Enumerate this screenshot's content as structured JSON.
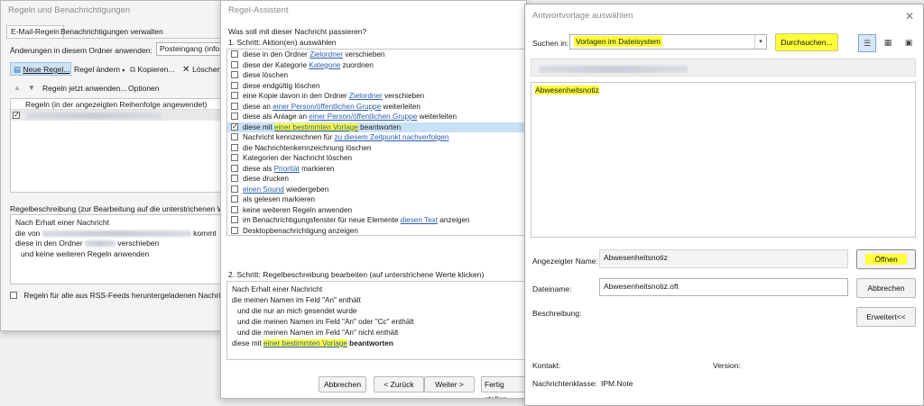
{
  "rules_window": {
    "title": "Regeln und Benachrichtigungen",
    "tabs": [
      "E-Mail-Regeln",
      "Benachrichtigungen verwalten"
    ],
    "folder_label": "Änderungen in diesem Ordner anwenden:",
    "folder_value": "Posteingang (info@",
    "toolbar": {
      "new_rule": "Neue Regel...",
      "change_rule": "Regel ändern",
      "copy": "Kopieren...",
      "delete": "Löschen"
    },
    "run_rules": "Regeln jetzt anwenden...",
    "options": "Optionen",
    "list_header": "Regeln (in der angezeigten Reihenfolge angewendet)",
    "desc_label": "Regelbeschreibung (zur Bearbeitung auf die unterstrichenen W",
    "desc_lines": {
      "l1": "Nach Erhalt einer Nachricht",
      "l2a": "die von",
      "l2b": "kommt",
      "l3a": "diese in den Ordner",
      "l3b": "verschieben",
      "l4": "und keine weiteren Regeln anwenden"
    },
    "rss_checkbox": "Regeln für alle aus RSS-Feeds heruntergeladenen Nachricht"
  },
  "wizard": {
    "title": "Regel-Assistent",
    "question": "Was soll mit dieser Nachricht passieren?",
    "step1": "1. Schritt: Aktion(en) auswählen",
    "actions": [
      {
        "pre": "diese in den Ordner ",
        "link": "Zielordner",
        "post": " verschieben",
        "checked": false
      },
      {
        "pre": "diese der Kategorie ",
        "link": "Kategorie",
        "post": " zuordnen",
        "checked": false
      },
      {
        "pre": "diese löschen",
        "link": "",
        "post": "",
        "checked": false
      },
      {
        "pre": "diese endgültig löschen",
        "link": "",
        "post": "",
        "checked": false
      },
      {
        "pre": "eine Kopie davon in den Ordner ",
        "link": "Zielordner",
        "post": " verschieben",
        "checked": false
      },
      {
        "pre": "diese an ",
        "link": "einer Person/öffentlichen Gruppe",
        "post": " weiterleiten",
        "checked": false
      },
      {
        "pre": "diese als Anlage an ",
        "link": "einer Person/öffentlichen Gruppe",
        "post": " weiterleiten",
        "checked": false
      },
      {
        "pre": "diese mit ",
        "link": "einer bestimmten Vorlage",
        "post": " beantworten",
        "checked": true
      },
      {
        "pre": "Nachricht kennzeichnen für ",
        "link": "zu diesem Zeitpunkt nachverfolgen",
        "post": "",
        "checked": false
      },
      {
        "pre": "die Nachrichtenkennzeichnung löschen",
        "link": "",
        "post": "",
        "checked": false
      },
      {
        "pre": "Kategorien der Nachricht löschen",
        "link": "",
        "post": "",
        "checked": false
      },
      {
        "pre": "diese als ",
        "link": "Priorität",
        "post": " markieren",
        "checked": false
      },
      {
        "pre": "diese drucken",
        "link": "",
        "post": "",
        "checked": false
      },
      {
        "pre": "",
        "link": "einen Sound",
        "post": " wiedergeben",
        "checked": false
      },
      {
        "pre": "als gelesen markieren",
        "link": "",
        "post": "",
        "checked": false
      },
      {
        "pre": "keine weiteren Regeln anwenden",
        "link": "",
        "post": "",
        "checked": false
      },
      {
        "pre": "im Benachrichtigungsfenster für neue Elemente ",
        "link": "diesen Text",
        "post": " anzeigen",
        "checked": false
      },
      {
        "pre": "Desktopbenachrichtigung anzeigen",
        "link": "",
        "post": "",
        "checked": false
      }
    ],
    "step2": "2. Schritt: Regelbeschreibung bearbeiten (auf unterstrichene Werte klicken)",
    "desc": {
      "l1": "Nach Erhalt einer Nachricht",
      "l2": "die meinen Namen im Feld \"An\" enthält",
      "l3": "und die nur an mich gesendet wurde",
      "l4": "und die meinen Namen im Feld \"An\" oder \"Cc\" enthält",
      "l5": "und die meinen Namen im Feld \"An\" nicht enthält",
      "l6_pre": "diese mit ",
      "l6_link": "einer bestimmten Vorlage",
      "l6_post": " beantworten"
    },
    "buttons": {
      "cancel": "Abbrechen",
      "back": "< Zurück",
      "next": "Weiter >",
      "finish": "Fertig stellen"
    }
  },
  "template_dialog": {
    "title": "Antwortvorlage auswählen",
    "search_label": "Suchen in:",
    "search_value": "Vorlagen im Dateisystem",
    "browse": "Durchsuchen...",
    "file_item": "Abwesenheitsnotiz",
    "display_name_label": "Angezeigter Name:",
    "display_name_value": "Abwesenheitsnotiz",
    "open_btn": "Öffnen",
    "filename_label": "Dateiname:",
    "filename_value": "Abwesenheitsnotiz.oft",
    "cancel_btn": "Abbrechen",
    "description_label": "Beschreibung:",
    "advanced_btn": "Erweitert<<",
    "contact_label": "Kontakt:",
    "version_label": "Version:",
    "class_label": "Nachrichtenklasse:",
    "class_value": "IPM.Note"
  },
  "colors": {
    "highlight": "#ffff3a",
    "link": "#2a5db0",
    "selection": "#c8e1f7"
  }
}
